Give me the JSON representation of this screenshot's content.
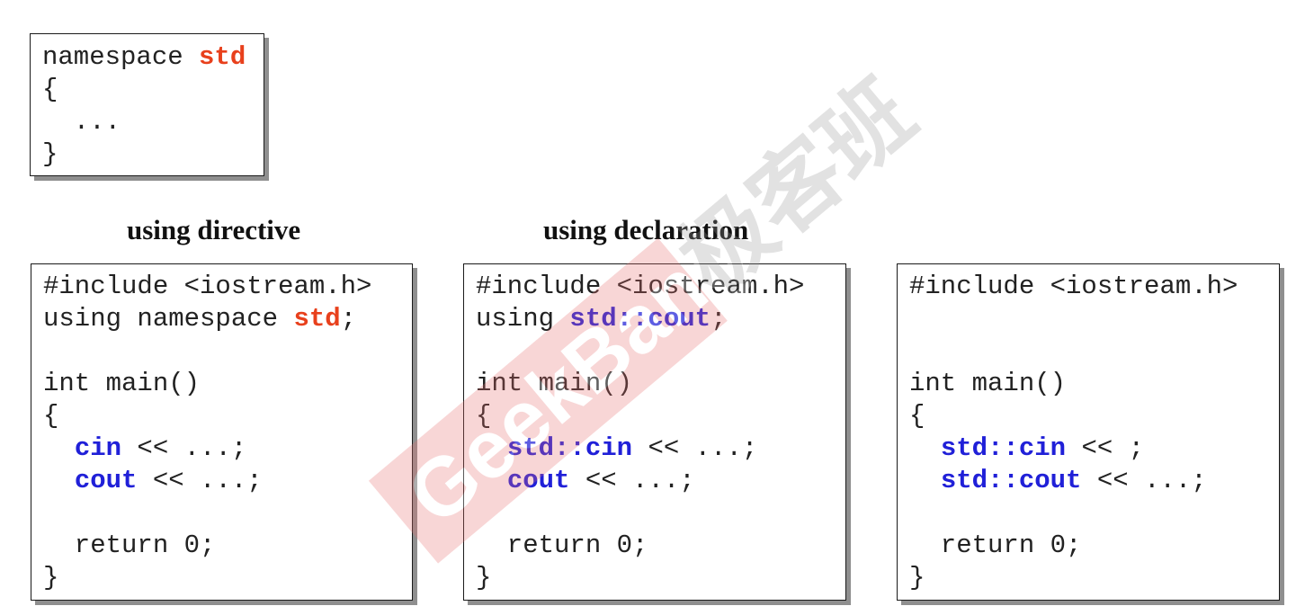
{
  "top_box": {
    "lines": [
      [
        {
          "t": "namespace "
        },
        {
          "t": "std",
          "c": "std"
        }
      ],
      [
        {
          "t": "{"
        }
      ],
      [
        {
          "t": "  ..."
        }
      ],
      [
        {
          "t": "}"
        }
      ]
    ]
  },
  "captions": {
    "left": "using directive",
    "middle": "using declaration"
  },
  "left_box": {
    "lines": [
      [
        {
          "t": "#include <iostream.h>"
        }
      ],
      [
        {
          "t": "using namespace "
        },
        {
          "t": "std",
          "c": "std"
        },
        {
          "t": ";"
        }
      ],
      [
        {
          "t": ""
        }
      ],
      [
        {
          "t": "int main()"
        }
      ],
      [
        {
          "t": "{"
        }
      ],
      [
        {
          "t": "  "
        },
        {
          "t": "cin",
          "c": "blue"
        },
        {
          "t": " << ...;"
        }
      ],
      [
        {
          "t": "  "
        },
        {
          "t": "cout",
          "c": "blue"
        },
        {
          "t": " << ...;"
        }
      ],
      [
        {
          "t": ""
        }
      ],
      [
        {
          "t": "  return 0;"
        }
      ],
      [
        {
          "t": "}"
        }
      ]
    ]
  },
  "middle_box": {
    "lines": [
      [
        {
          "t": "#include <iostream.h>"
        }
      ],
      [
        {
          "t": "using "
        },
        {
          "t": "std::cout",
          "c": "blue"
        },
        {
          "t": ";"
        }
      ],
      [
        {
          "t": ""
        }
      ],
      [
        {
          "t": "int main()"
        }
      ],
      [
        {
          "t": "{"
        }
      ],
      [
        {
          "t": "  "
        },
        {
          "t": "std::cin",
          "c": "blue"
        },
        {
          "t": " << ...;"
        }
      ],
      [
        {
          "t": "  "
        },
        {
          "t": "cout",
          "c": "blue"
        },
        {
          "t": " << ...;"
        }
      ],
      [
        {
          "t": ""
        }
      ],
      [
        {
          "t": "  return 0;"
        }
      ],
      [
        {
          "t": "}"
        }
      ]
    ]
  },
  "right_box": {
    "lines": [
      [
        {
          "t": "#include <iostream.h>"
        }
      ],
      [
        {
          "t": ""
        }
      ],
      [
        {
          "t": ""
        }
      ],
      [
        {
          "t": "int main()"
        }
      ],
      [
        {
          "t": "{"
        }
      ],
      [
        {
          "t": "  "
        },
        {
          "t": "std::cin",
          "c": "blue"
        },
        {
          "t": " << ;"
        }
      ],
      [
        {
          "t": "  "
        },
        {
          "t": "std::cout",
          "c": "blue"
        },
        {
          "t": " << ...;"
        }
      ],
      [
        {
          "t": ""
        }
      ],
      [
        {
          "t": "  return 0;"
        }
      ],
      [
        {
          "t": "}"
        }
      ]
    ]
  },
  "watermark": {
    "latin": "GeekBang",
    "cjk": "极客班"
  },
  "colors": {
    "std_keyword": "#e8401c",
    "blue_keyword": "#2020d8",
    "watermark": "#e87070"
  }
}
